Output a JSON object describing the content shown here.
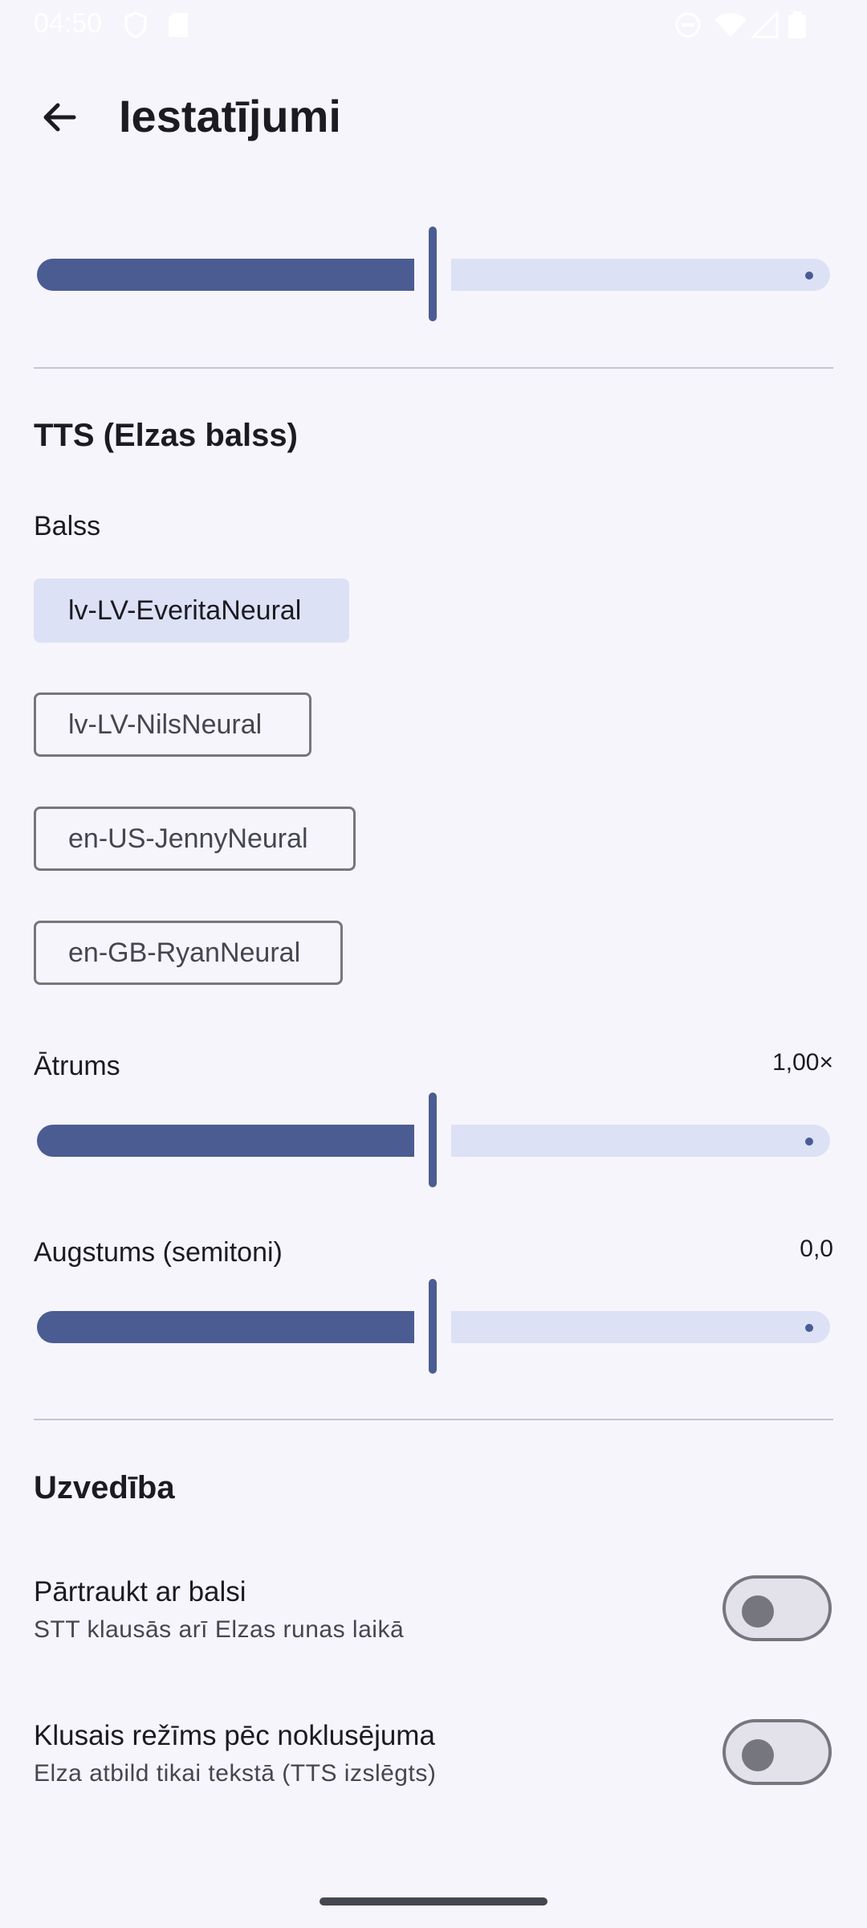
{
  "status_bar": {
    "time": "04:50"
  },
  "app_bar": {
    "title": "Iestatījumi"
  },
  "top_slider": {
    "value_fraction": 0.5
  },
  "tts": {
    "section_title": "TTS (Elzas balss)",
    "voice_label": "Balss",
    "voices": [
      {
        "label": "lv-LV-EveritaNeural",
        "selected": true
      },
      {
        "label": "lv-LV-NilsNeural",
        "selected": false
      },
      {
        "label": "en-US-JennyNeural",
        "selected": false
      },
      {
        "label": "en-GB-RyanNeural",
        "selected": false
      }
    ],
    "speed": {
      "label": "Ātrums",
      "value": "1,00×",
      "value_fraction": 0.5
    },
    "pitch": {
      "label": "Augstums (semitoni)",
      "value": "0,0",
      "value_fraction": 0.5
    }
  },
  "behavior": {
    "section_title": "Uzvedība",
    "interrupt": {
      "title": "Pārtraukt ar balsi",
      "subtitle": "STT klausās arī Elzas runas laikā",
      "enabled": false
    },
    "silent": {
      "title": "Klusais režīms pēc noklusējuma",
      "subtitle": "Elza atbild tikai tekstā (TTS izslēgts)",
      "enabled": false
    }
  },
  "colors": {
    "accent": "#4a5c92",
    "track_inactive": "#dde1f6",
    "background": "#f6f5fb"
  }
}
